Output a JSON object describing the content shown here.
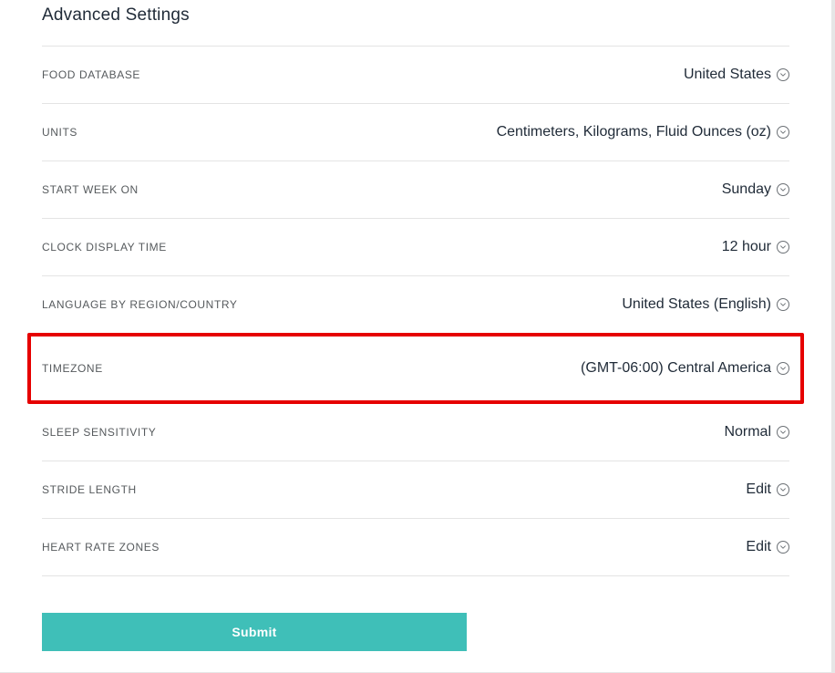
{
  "section_title": "Advanced Settings",
  "rows": {
    "food_database": {
      "label": "FOOD DATABASE",
      "value": "United States"
    },
    "units": {
      "label": "UNITS",
      "value": "Centimeters, Kilograms, Fluid Ounces (oz)"
    },
    "start_week_on": {
      "label": "START WEEK ON",
      "value": "Sunday"
    },
    "clock_display_time": {
      "label": "CLOCK DISPLAY TIME",
      "value": "12 hour"
    },
    "language": {
      "label": "LANGUAGE BY REGION/COUNTRY",
      "value": "United States (English)"
    },
    "timezone": {
      "label": "TIMEZONE",
      "value": "(GMT-06:00) Central America"
    },
    "sleep_sensitivity": {
      "label": "SLEEP SENSITIVITY",
      "value": "Normal"
    },
    "stride_length": {
      "label": "STRIDE LENGTH",
      "value": "Edit"
    },
    "heart_rate_zones": {
      "label": "HEART RATE ZONES",
      "value": "Edit"
    }
  },
  "submit_label": "Submit"
}
